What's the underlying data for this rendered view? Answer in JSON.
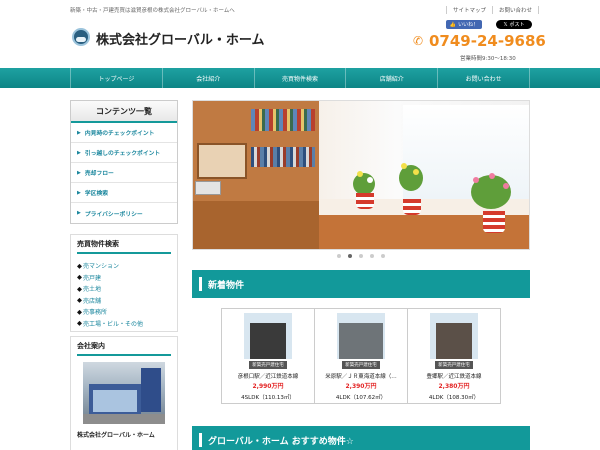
{
  "header": {
    "tagline": "新築・中古・戸建売買は滋賀彦根の株式会社グローバル・ホームへ",
    "top_links": [
      "サイトマップ",
      "お問い合わせ"
    ],
    "social": {
      "like_label": "いいね！",
      "post_label": "ポスト"
    },
    "company_name": "株式会社グローバル・ホーム",
    "phone": "0749-24-9686",
    "hours": "営業時間9:30～18:30"
  },
  "nav": [
    "トップページ",
    "会社紹介",
    "売買物件検索",
    "店舗紹介",
    "お問い合わせ"
  ],
  "sidebar": {
    "contents_title": "コンテンツ一覧",
    "contents": [
      "内見時のチェックポイント",
      "引っ越しのチェックポイント",
      "売却フロー",
      "学区検索",
      "プライバシーポリシー"
    ],
    "search_title": "売買物件検索",
    "search_links": [
      "売マンション",
      "売戸建",
      "売土地",
      "売店舗",
      "売事務所",
      "売工場・ビル・その他"
    ],
    "company_title": "会社案内",
    "company_caption": "株式会社グローバル・ホーム"
  },
  "slider": {
    "dot_count": 5,
    "active_dot": 1
  },
  "main": {
    "new_title": "新着物件",
    "listings": [
      {
        "tag": "新築売戸建住宅",
        "station": "彦根口駅／近江鉄道本線",
        "price": "2,990万円",
        "layout": "4SLDK（110.13㎡）"
      },
      {
        "tag": "新築売戸建住宅",
        "station": "米原駅／ＪＲ東海道本線（…",
        "price": "2,390万円",
        "layout": "4LDK（107.62㎡）"
      },
      {
        "tag": "新築売戸建住宅",
        "station": "豊郷駅／近江鉄道本線",
        "price": "2,380万円",
        "layout": "4LDK（108.30㎡）"
      }
    ],
    "reco_title": "グローバル・ホーム おすすめ物件☆"
  },
  "colors": {
    "teal": "#12999a",
    "orange": "#f08c1e",
    "link": "#19869d",
    "price_red": "#e32424"
  }
}
